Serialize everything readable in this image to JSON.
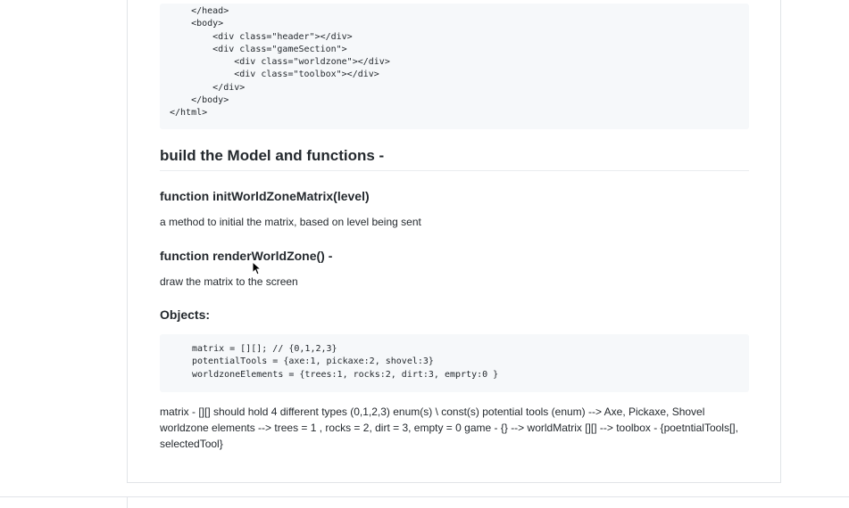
{
  "code_top": {
    "lines": [
      "    </head>",
      "    <body>",
      "        <div class=\"header\"></div>",
      "        <div class=\"gameSection\">",
      "            <div class=\"worldzone\"></div>",
      "            <div class=\"toolbox\"></div>",
      "        </div>",
      "    </body>",
      "</html>"
    ]
  },
  "headings": {
    "model": "build the Model and functions -",
    "init": "function initWorldZoneMatrix(level)",
    "render": "function renderWorldZone() -",
    "objects": "Objects:"
  },
  "paragraphs": {
    "init": "a method to initial the matrix, based on level being sent",
    "render": "draw the matrix to the screen",
    "matrix": "matrix - [][] should hold 4 different types (0,1,2,3) enum(s) \\ const(s) potential tools (enum) --> Axe, Pickaxe, Shovel worldzone elements --> trees = 1 , rocks = 2, dirt = 3, empty = 0 game - {} --> worldMatrix [][] --> toolbox - {poetntialTools[], selectedTool}"
  },
  "code_objects": {
    "lines": [
      "matrix = [][]; // {0,1,2,3}",
      "potentialTools = {axe:1, pickaxe:2, shovel:3}",
      "worldzoneElements = {trees:1, rocks:2, dirt:3, emprty:0 }"
    ]
  },
  "icons": {
    "cursor": "mouse-pointer-icon"
  }
}
